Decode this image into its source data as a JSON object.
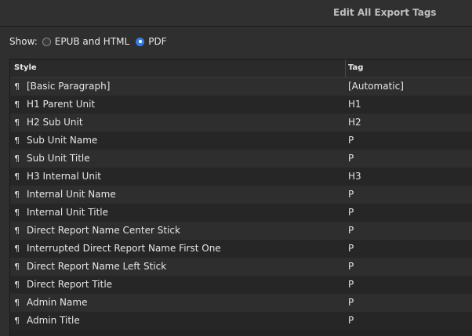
{
  "window": {
    "title": "Edit All Export Tags"
  },
  "show": {
    "label": "Show:",
    "options": [
      {
        "label": "EPUB and HTML",
        "selected": false
      },
      {
        "label": "PDF",
        "selected": true
      }
    ]
  },
  "table": {
    "columns": {
      "style": "Style",
      "tag": "Tag"
    },
    "rows": [
      {
        "style": "[Basic Paragraph]",
        "tag": "[Automatic]"
      },
      {
        "style": "H1 Parent Unit",
        "tag": "H1"
      },
      {
        "style": "H2 Sub Unit",
        "tag": "H2"
      },
      {
        "style": "Sub Unit Name",
        "tag": "P"
      },
      {
        "style": "Sub Unit Title",
        "tag": "P"
      },
      {
        "style": "H3 Internal Unit",
        "tag": "H3"
      },
      {
        "style": "Internal Unit Name",
        "tag": "P"
      },
      {
        "style": "Internal Unit Title",
        "tag": "P"
      },
      {
        "style": "Direct Report Name Center Stick",
        "tag": "P"
      },
      {
        "style": "Interrupted Direct Report Name First One",
        "tag": "P"
      },
      {
        "style": "Direct Report Name Left Stick",
        "tag": "P"
      },
      {
        "style": "Direct Report Title",
        "tag": "P"
      },
      {
        "style": "Admin Name",
        "tag": "P"
      },
      {
        "style": "Admin Title",
        "tag": "P"
      }
    ]
  },
  "icons": {
    "paragraph_style": "pilcrow-icon"
  },
  "colors": {
    "radio_selected": "#2f7fe3"
  }
}
